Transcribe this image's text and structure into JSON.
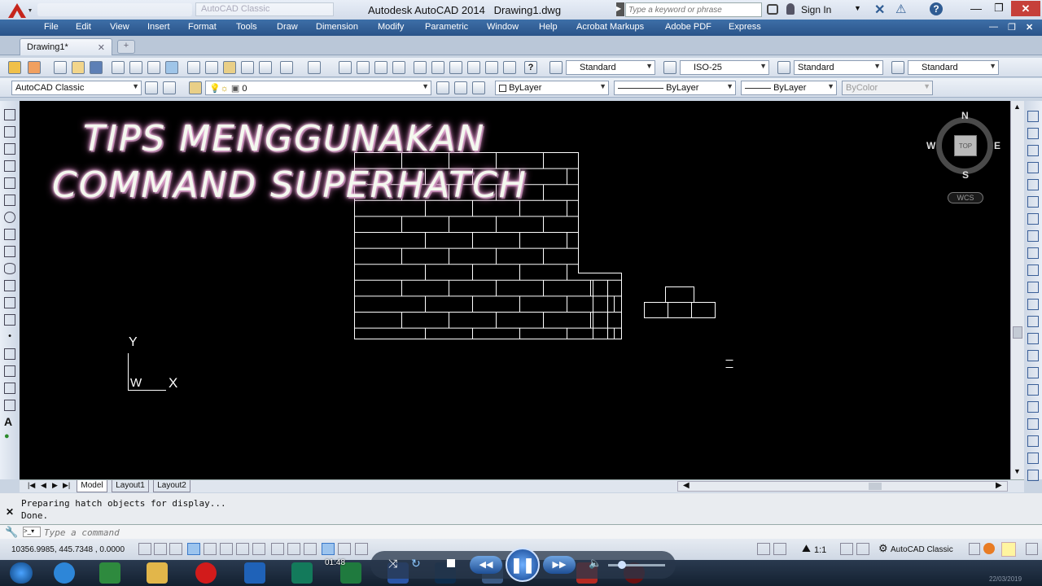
{
  "app": {
    "title": "Autodesk AutoCAD 2014",
    "document": "Drawing1.dwg",
    "workspace_title": "AutoCAD Classic"
  },
  "search": {
    "placeholder": "Type a keyword or phrase"
  },
  "account": {
    "sign_in": "Sign In"
  },
  "menu": [
    "File",
    "Edit",
    "View",
    "Insert",
    "Format",
    "Tools",
    "Draw",
    "Dimension",
    "Modify",
    "Parametric",
    "Window",
    "Help",
    "Acrobat Markups",
    "Adobe PDF",
    "Express"
  ],
  "doc_tab": {
    "label": "Drawing1*"
  },
  "styles": {
    "text": "Standard",
    "dim": "ISO-25",
    "table": "Standard",
    "mleader": "Standard"
  },
  "workspace": {
    "value": "AutoCAD Classic"
  },
  "layer": {
    "value": "0"
  },
  "properties": {
    "color": "ByLayer",
    "linetype": "ByLayer",
    "lineweight": "ByLayer",
    "plotstyle": "ByColor"
  },
  "overlay": {
    "line1": "TIPS MENGGUNAKAN",
    "line2": "COMMAND SUPERHATCH"
  },
  "viewcube": {
    "n": "N",
    "s": "S",
    "e": "E",
    "w": "W",
    "face": "TOP",
    "wcs": "WCS"
  },
  "ucs": {
    "x": "X",
    "y": "Y",
    "w": "W"
  },
  "layout_tabs": [
    "Model",
    "Layout1",
    "Layout2"
  ],
  "command": {
    "history": [
      "Preparing hatch objects for display...",
      "Done."
    ],
    "placeholder": "Type a command"
  },
  "status": {
    "coords": "10356.9985, 445.7348 , 0.0000",
    "scale": "1:1",
    "workspace": "AutoCAD Classic"
  },
  "player": {
    "time": "01:48"
  },
  "clock": {
    "date": "22/03/2019"
  },
  "colors": {
    "canvas": "#000000",
    "menubar": "#2f5c93",
    "overlay_glow": "#e9a6d6"
  }
}
